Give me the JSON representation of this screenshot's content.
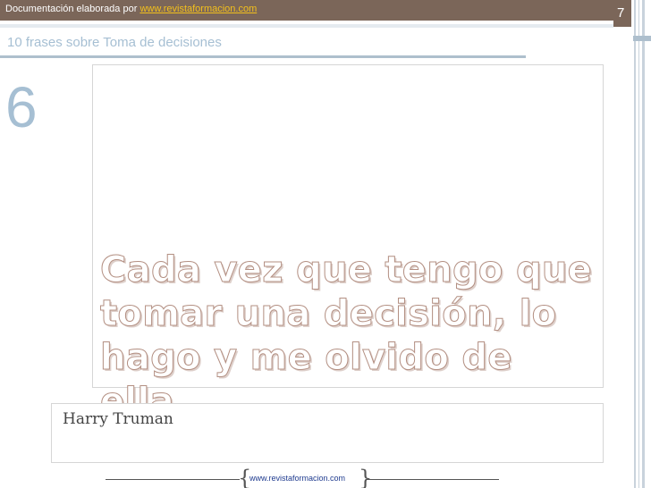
{
  "header": {
    "credit_prefix": "Documentación elaborada por ",
    "credit_link": "www.revistaformacion.com",
    "page_number": "7"
  },
  "slide": {
    "title": "10 frases sobre Toma de decisiones",
    "number": "6",
    "quote_lines": [
      "Cada vez que tengo que",
      "tomar una decisión, lo",
      "hago y me olvido de ella."
    ],
    "author": "Harry Truman"
  },
  "footer": {
    "url": "www.revistaformacion.com"
  },
  "colors": {
    "header_bar": "#7b6659",
    "link_yellow": "#f3c01c",
    "title_blue": "#a6bfd3",
    "quote_outline": "#b38f82"
  }
}
